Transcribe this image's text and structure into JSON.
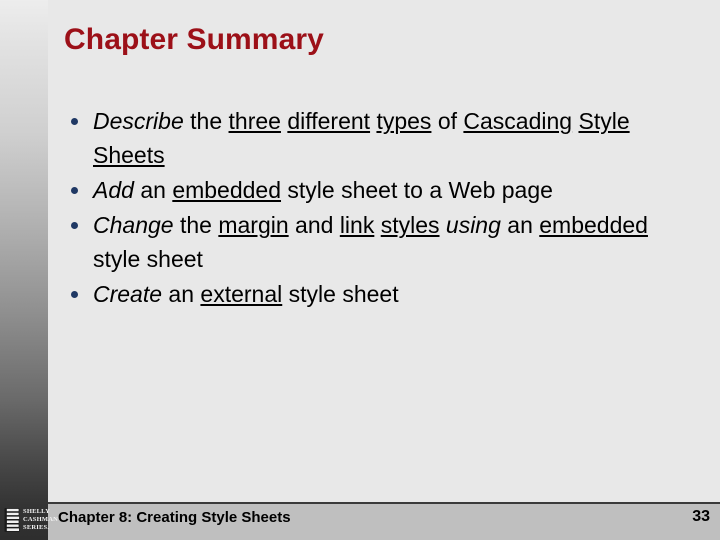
{
  "slide": {
    "title": "Chapter Summary",
    "title_color": "#9C1018",
    "background_color": "#E8E8E8",
    "bullet_color": "#1F3864",
    "bullets": [
      {
        "segments": [
          {
            "text": "Describe",
            "style": "italic"
          },
          {
            "text": " the ",
            "style": "normal"
          },
          {
            "text": "three",
            "style": "underline"
          },
          {
            "text": " ",
            "style": "normal"
          },
          {
            "text": "different",
            "style": "underline"
          },
          {
            "text": " ",
            "style": "normal"
          },
          {
            "text": "types",
            "style": "underline"
          },
          {
            "text": " of ",
            "style": "normal"
          },
          {
            "text": "Cascading",
            "style": "underline"
          },
          {
            "text": " ",
            "style": "normal"
          },
          {
            "text": "Style",
            "style": "underline"
          },
          {
            "text": " ",
            "style": "normal"
          },
          {
            "text": "Sheets",
            "style": "underline"
          }
        ]
      },
      {
        "segments": [
          {
            "text": "Add",
            "style": "italic"
          },
          {
            "text": " an ",
            "style": "normal"
          },
          {
            "text": "embedded",
            "style": "underline"
          },
          {
            "text": " style sheet to a Web page",
            "style": "normal"
          }
        ]
      },
      {
        "segments": [
          {
            "text": "Change",
            "style": "italic"
          },
          {
            "text": " the ",
            "style": "normal"
          },
          {
            "text": "margin",
            "style": "underline"
          },
          {
            "text": " and ",
            "style": "normal"
          },
          {
            "text": "link",
            "style": "underline"
          },
          {
            "text": " ",
            "style": "normal"
          },
          {
            "text": "styles",
            "style": "underline"
          },
          {
            "text": " ",
            "style": "normal"
          },
          {
            "text": "using",
            "style": "italic"
          },
          {
            "text": " an ",
            "style": "normal"
          },
          {
            "text": "embedded",
            "style": "underline"
          },
          {
            "text": " style sheet",
            "style": "normal"
          }
        ]
      },
      {
        "segments": [
          {
            "text": "Create",
            "style": "italic"
          },
          {
            "text": " an ",
            "style": "normal"
          },
          {
            "text": "external",
            "style": "underline"
          },
          {
            "text": " style sheet",
            "style": "normal"
          }
        ]
      }
    ]
  },
  "footer": {
    "title": "Chapter 8: Creating Style Sheets",
    "page_number": "33",
    "band_color": "#BFBFBF",
    "logo": {
      "line1": "SHELLY",
      "line2": "CASHMAN",
      "line3": "SERIES."
    }
  }
}
